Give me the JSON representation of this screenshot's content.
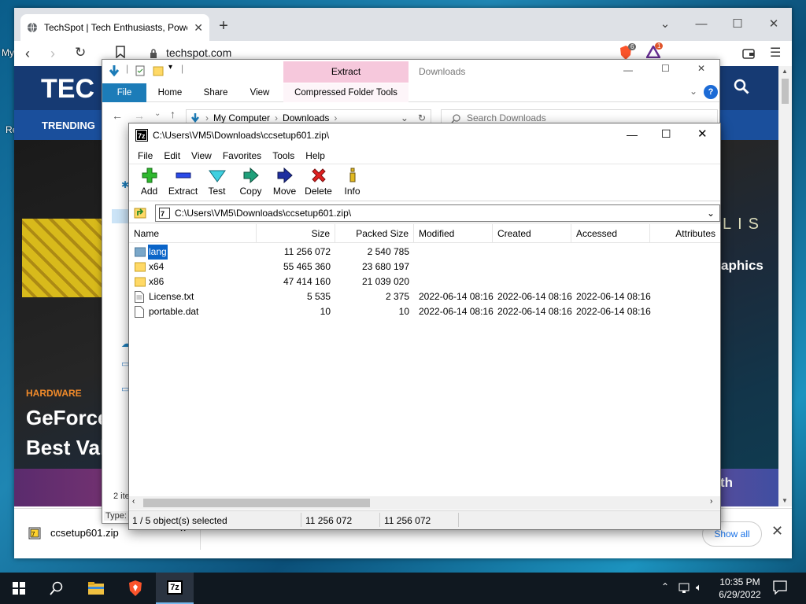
{
  "desktop": {
    "stray_text_my": "My",
    "stray_text_re": "Re"
  },
  "browser": {
    "tab_title": "TechSpot | Tech Enthusiasts, Powe",
    "url": "techspot.com",
    "brave_badge": "6",
    "rewards_badge": "1",
    "site": {
      "logo": "TEC",
      "nav_trending": "TRENDING",
      "hero_category": "HARDWARE",
      "headline_line1": "GeForce",
      "headline_line2": "Best Val",
      "right_ghost_lis": "LIS",
      "right_ghost_text1": "aphics",
      "right_ghost_text2": "th"
    },
    "downloads_bar": {
      "file_name": "ccsetup601.zip",
      "show_all": "Show all"
    }
  },
  "explorer": {
    "context_tab": "Extract",
    "window_title": "Downloads",
    "ribbon_tabs": [
      "File",
      "Home",
      "Share",
      "View",
      "Compressed Folder Tools"
    ],
    "breadcrumb": [
      "My Computer",
      "Downloads"
    ],
    "search_placeholder": "Search Downloads",
    "items_count": "2 ite",
    "type_label": "Type:"
  },
  "sevenzip": {
    "title": "C:\\Users\\VM5\\Downloads\\ccsetup601.zip\\",
    "menu": [
      "File",
      "Edit",
      "View",
      "Favorites",
      "Tools",
      "Help"
    ],
    "tools": [
      {
        "label": "Add",
        "icon": "plus-icon",
        "color": "#22a822"
      },
      {
        "label": "Extract",
        "icon": "minus-icon",
        "color": "#1a3bd8"
      },
      {
        "label": "Test",
        "icon": "check-icon",
        "color": "#1eb6c8"
      },
      {
        "label": "Copy",
        "icon": "double-arrow-icon",
        "color": "#1a8a6a"
      },
      {
        "label": "Move",
        "icon": "arrow-right-icon",
        "color": "#1a2a8a"
      },
      {
        "label": "Delete",
        "icon": "x-icon",
        "color": "#d81e1e"
      },
      {
        "label": "Info",
        "icon": "info-icon",
        "color": "#d8b01e"
      }
    ],
    "path": "C:\\Users\\VM5\\Downloads\\ccsetup601.zip\\",
    "columns": [
      "Name",
      "Size",
      "Packed Size",
      "Modified",
      "Created",
      "Accessed",
      "Attributes"
    ],
    "rows": [
      {
        "name": "lang",
        "type": "folder",
        "size": "11 256 072",
        "packed": "2 540 785",
        "modified": "",
        "created": "",
        "accessed": "",
        "selected": true
      },
      {
        "name": "x64",
        "type": "folder",
        "size": "55 465 360",
        "packed": "23 680 197",
        "modified": "",
        "created": "",
        "accessed": ""
      },
      {
        "name": "x86",
        "type": "folder",
        "size": "47 414 160",
        "packed": "21 039 020",
        "modified": "",
        "created": "",
        "accessed": ""
      },
      {
        "name": "License.txt",
        "type": "file",
        "size": "5 535",
        "packed": "2 375",
        "modified": "2022-06-14 08:16",
        "created": "2022-06-14 08:16",
        "accessed": "2022-06-14 08:16"
      },
      {
        "name": "portable.dat",
        "type": "file",
        "size": "10",
        "packed": "10",
        "modified": "2022-06-14 08:16",
        "created": "2022-06-14 08:16",
        "accessed": "2022-06-14 08:16"
      }
    ],
    "status": {
      "selection": "1 / 5 object(s) selected",
      "size": "11 256 072",
      "packed": "11 256 072"
    }
  },
  "taskbar": {
    "time": "10:35 PM",
    "date": "6/29/2022",
    "sevenzip_label": "7z"
  }
}
